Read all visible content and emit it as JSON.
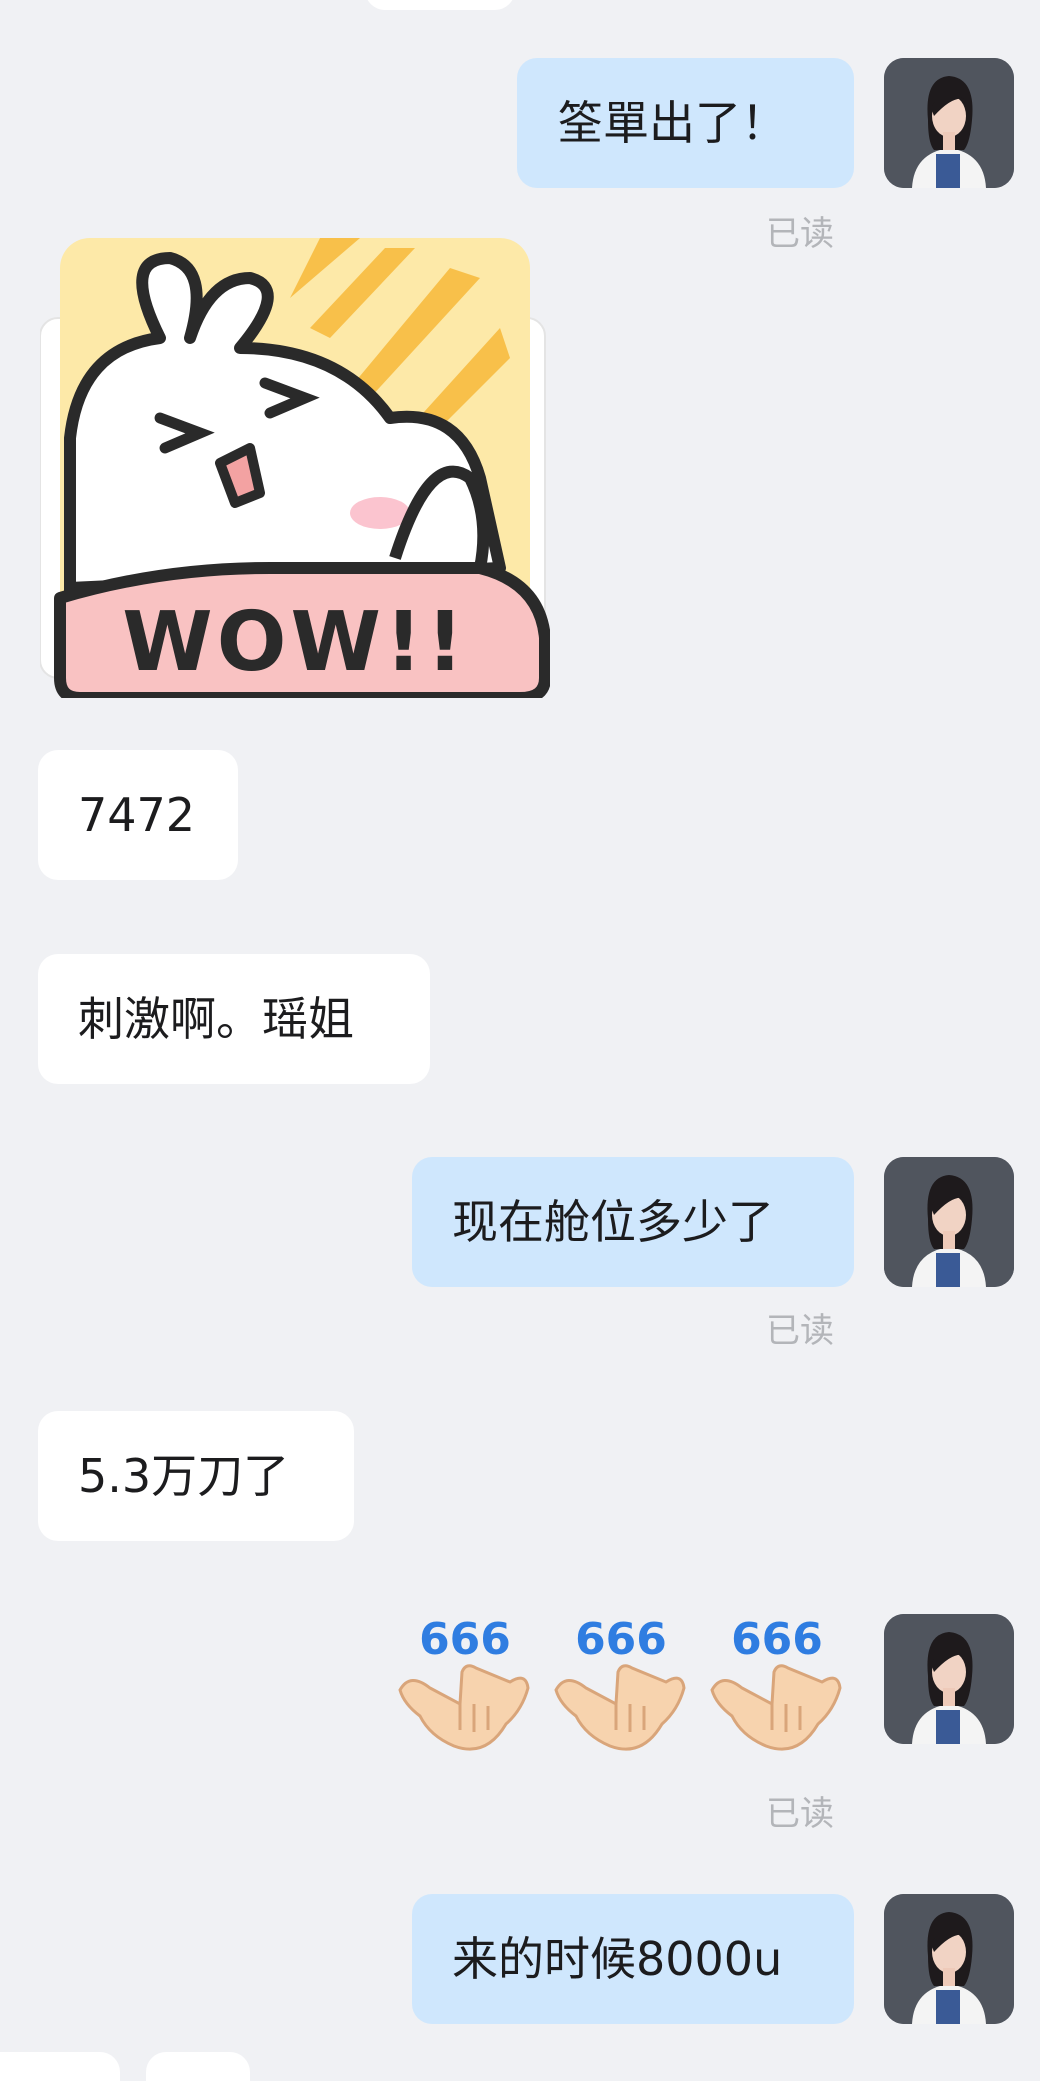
{
  "chat": {
    "messages": [
      {
        "side": "out",
        "type": "text",
        "text": "筌單出了！",
        "read_label": "已读"
      },
      {
        "side": "in",
        "type": "sticker",
        "sticker": "wow-bunny-sticker",
        "text": "WOW!!"
      },
      {
        "side": "in",
        "type": "text",
        "text": "7472"
      },
      {
        "side": "in",
        "type": "text",
        "text": "刺激啊。瑶姐"
      },
      {
        "side": "out",
        "type": "text",
        "text": "现在舱位多少了",
        "read_label": "已读"
      },
      {
        "side": "in",
        "type": "text",
        "text": "5.3万刀了"
      },
      {
        "side": "out",
        "type": "emoji",
        "emoji": [
          "666-hand-emoji",
          "666-hand-emoji",
          "666-hand-emoji"
        ],
        "emoji_text": "666",
        "read_label": "已读"
      },
      {
        "side": "out",
        "type": "text",
        "text": "来的时候8000u"
      }
    ]
  },
  "colors": {
    "background": "#f0f1f4",
    "outgoing_bubble": "#cfe7fd",
    "incoming_bubble": "#ffffff",
    "read_receipt": "#b3b5b9",
    "emoji_text": "#2f7de1"
  },
  "icons": {
    "avatar": "woman-portrait-avatar"
  }
}
